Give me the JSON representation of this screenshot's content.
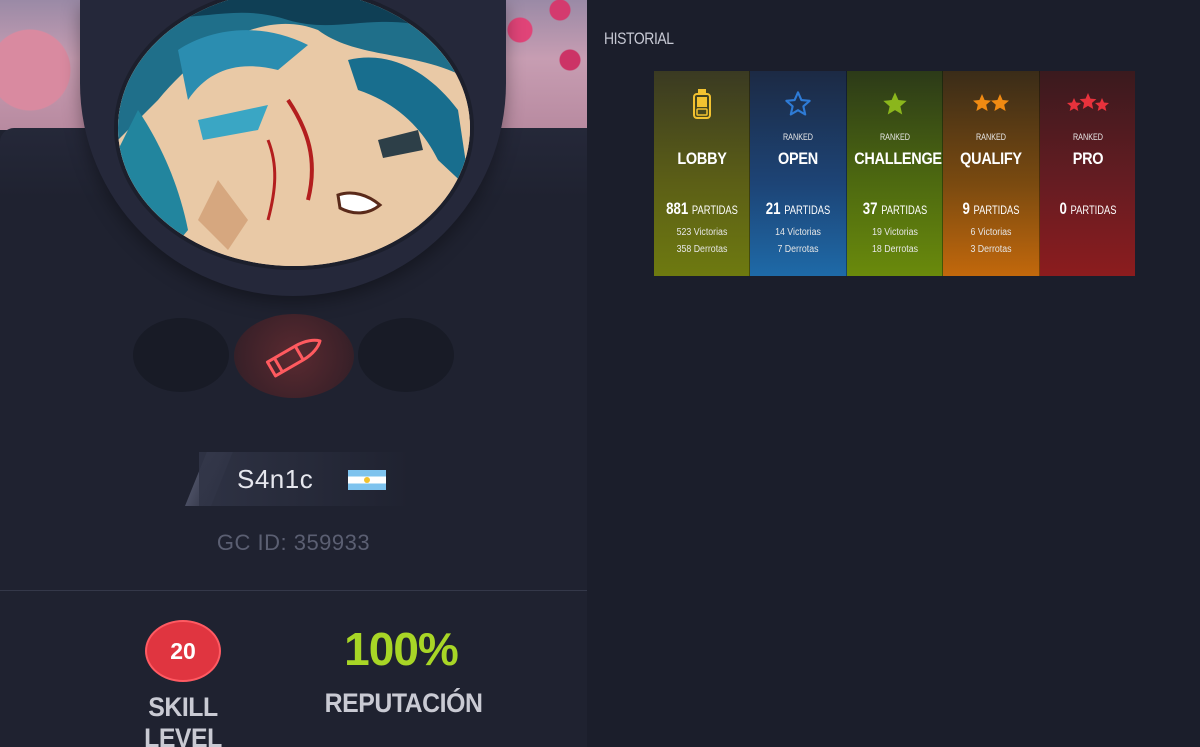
{
  "profile": {
    "username": "S4n1c",
    "gc_id": "GC ID: 359933",
    "skill_level": "20",
    "skill_label": "SKILL LEVEL",
    "reputation": "100%",
    "reputation_label": "REPUTACIÓN",
    "flag": "argentina-flag",
    "badge_icon": "bullet-icon"
  },
  "history": {
    "title": "HISTORIAL",
    "cards": [
      {
        "ranked": "",
        "title": "LOBBY",
        "count": "881",
        "partidas_label": "PARTIDAS",
        "wins": "523 Victorias",
        "losses": "358 Derrotas",
        "icon": "tag-icon",
        "color": "#f2c230"
      },
      {
        "ranked": "RANKED",
        "title": "OPEN",
        "count": "21",
        "partidas_label": "PARTIDAS",
        "wins": "14 Victorias",
        "losses": "7 Derrotas",
        "icon": "star-outline-icon",
        "color": "#2e7bd6"
      },
      {
        "ranked": "RANKED",
        "title": "CHALLENGE",
        "count": "37",
        "partidas_label": "PARTIDAS",
        "wins": "19 Victorias",
        "losses": "18 Derrotas",
        "icon": "star-icon",
        "color": "#8bb61c"
      },
      {
        "ranked": "RANKED",
        "title": "QUALIFY",
        "count": "9",
        "partidas_label": "PARTIDAS",
        "wins": "6 Victorias",
        "losses": "3 Derrotas",
        "icon": "two-stars-icon",
        "color": "#f08a12"
      },
      {
        "ranked": "RANKED",
        "title": "PRO",
        "count": "0",
        "partidas_label": "PARTIDAS",
        "wins": "",
        "losses": "",
        "icon": "three-stars-icon",
        "color": "#e8323c"
      }
    ]
  }
}
